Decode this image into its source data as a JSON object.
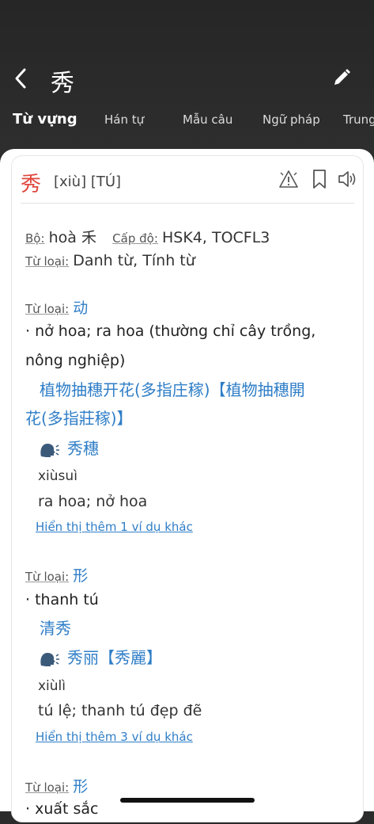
{
  "header": {
    "title": "秀",
    "tabs": [
      "Từ vựng",
      "Hán tự",
      "Mẫu câu",
      "Ngữ pháp",
      "Trung"
    ]
  },
  "entry": {
    "char": "秀",
    "pron": "[xiù] [TÚ]",
    "radical_label": "Bộ:",
    "radical_value": "hoà 禾",
    "level_label": "Cấp độ:",
    "level_value": "HSK4, TOCFL3",
    "pos_label": "Từ loại:",
    "pos_value": "Danh từ, Tính từ"
  },
  "senses": [
    {
      "pos_label": "Từ loại:",
      "pos_value": "动",
      "def1": "· nở hoa; ra hoa (thường chỉ cây trồng,",
      "def2": "nông nghiệp)",
      "ex_zh1": "植物抽穗开花(多指庄稼)【植物抽穗開",
      "ex_zh2": "花(多指莊稼)】",
      "word": "秀穗",
      "pinyin": "xiùsuì",
      "meaning": "ra hoa; nở hoa",
      "more": "Hiển thị thêm 1 ví dụ khác"
    },
    {
      "pos_label": "Từ loại:",
      "pos_value": "形",
      "def1": "· thanh tú",
      "ex_zh1": "清秀",
      "word": "秀丽【秀麗】",
      "pinyin": "xiùlì",
      "meaning": "tú lệ; thanh tú đẹp đẽ",
      "more": "Hiển thị thêm 3 ví dụ khác"
    },
    {
      "pos_label": "Từ loại:",
      "pos_value": "形",
      "def1": "· xuất sắc"
    }
  ]
}
